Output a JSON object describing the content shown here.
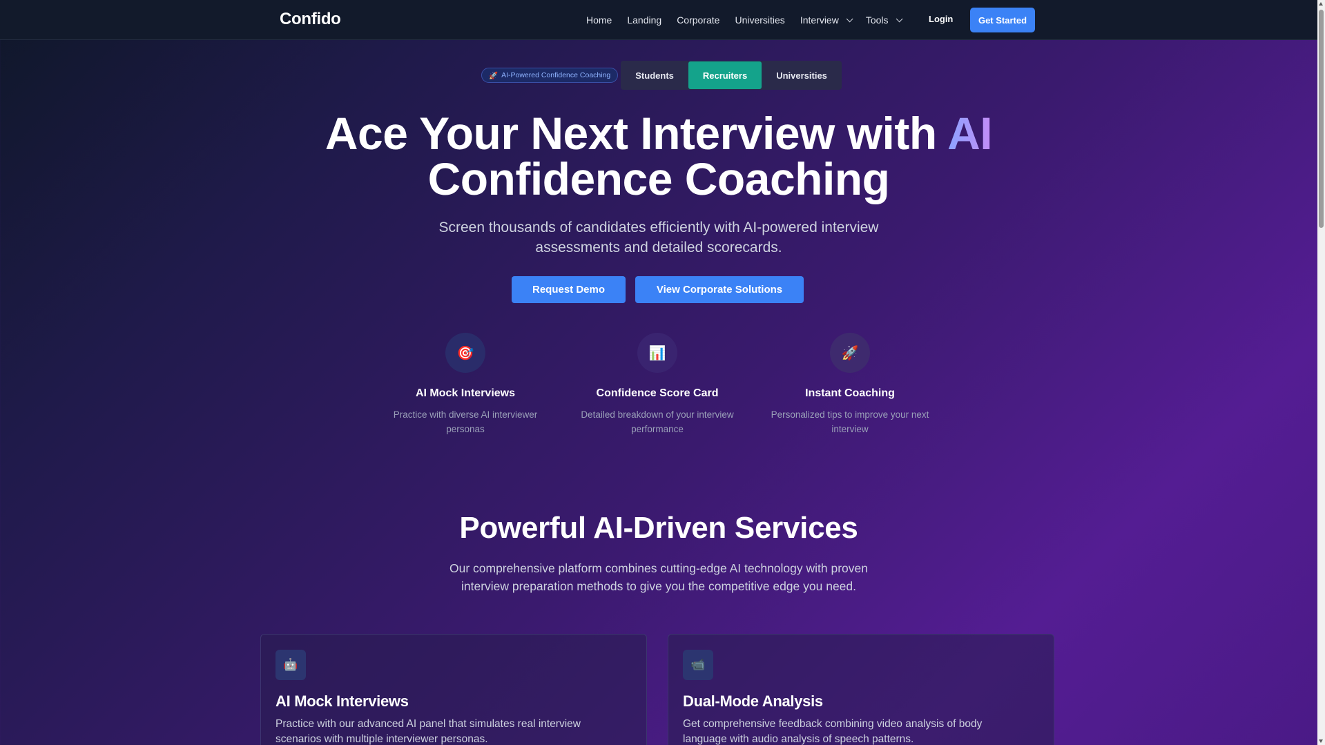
{
  "nav": {
    "logo": "Confido",
    "links": [
      {
        "label": "Home"
      },
      {
        "label": "Landing"
      },
      {
        "label": "Corporate"
      },
      {
        "label": "Universities"
      },
      {
        "label": "Interview",
        "dropdown": true
      },
      {
        "label": "Tools",
        "dropdown": true
      }
    ],
    "login": "Login",
    "get_started": "Get Started"
  },
  "hero": {
    "badge": "AI-Powered Confidence Coaching",
    "badge_icon": "rocket-icon",
    "tabs": [
      {
        "label": "Students",
        "active": false
      },
      {
        "label": "Recruiters",
        "active": true
      },
      {
        "label": "Universities",
        "active": false
      }
    ],
    "title_part1": "Ace Your Next Interview with",
    "title_highlight": "AI",
    "title_part2": "Confidence Coaching",
    "subtitle_line1": "Screen thousands of candidates efficiently with AI-powered interview",
    "subtitle_line2": "assessments and detailed scorecards.",
    "cta_primary": "Request Demo",
    "cta_secondary": "View Corporate Solutions",
    "features": [
      {
        "icon": "target-icon",
        "glyph": "🎯",
        "title": "AI Mock Interviews",
        "desc_line1": "Practice with diverse AI interviewer",
        "desc_line2": "personas"
      },
      {
        "icon": "chart-icon",
        "glyph": "📊",
        "title": "Confidence Score Card",
        "desc_line1": "Detailed breakdown of your interview",
        "desc_line2": "performance"
      },
      {
        "icon": "rocket-icon",
        "glyph": "🚀",
        "title": "Instant Coaching",
        "desc_line1": "Personalized tips to improve your next",
        "desc_line2": "interview"
      }
    ]
  },
  "services": {
    "title": "Powerful AI-Driven Services",
    "subtitle_line1": "Our comprehensive platform combines cutting-edge AI technology with proven",
    "subtitle_line2": "interview preparation methods to give you the competitive edge you need.",
    "cards": [
      {
        "icon": "robot-icon",
        "glyph": "🤖",
        "title": "AI Mock Interviews",
        "desc_line1": "Practice with our advanced AI panel that simulates real interview",
        "desc_line2": "scenarios with multiple interviewer personas."
      },
      {
        "icon": "video-camera-icon",
        "glyph": "📹",
        "title": "Dual-Mode Analysis",
        "desc_line1": "Get comprehensive feedback combining video analysis of body",
        "desc_line2": "language with audio analysis of speech patterns."
      }
    ]
  },
  "colors": {
    "accent": "#3b82f6",
    "active_tab": "#14a38b",
    "nav_bg": "#121a2b"
  }
}
